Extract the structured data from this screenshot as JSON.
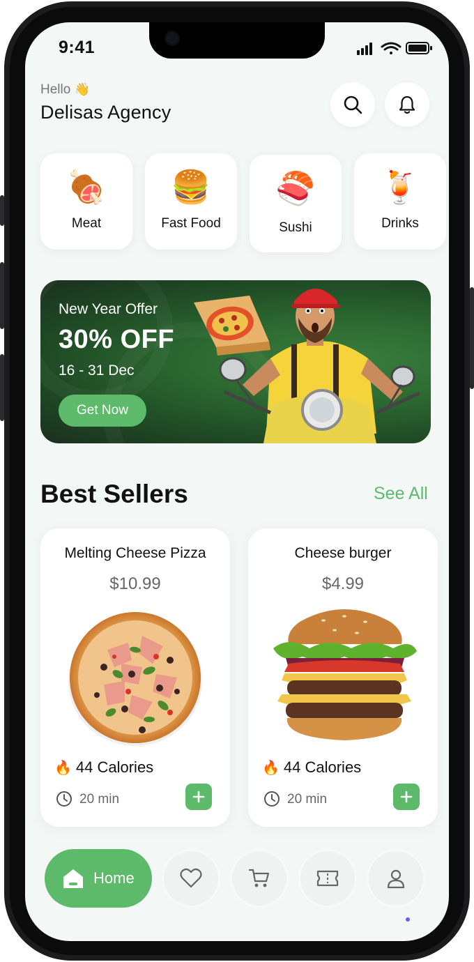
{
  "status_bar": {
    "time": "9:41"
  },
  "header": {
    "greeting": "Hello",
    "greeting_emoji": "👋",
    "username": "Delisas Agency",
    "search_icon": "search-icon",
    "bell_icon": "bell-icon"
  },
  "categories": [
    {
      "label": "Meat",
      "emoji": "🍖"
    },
    {
      "label": "Fast Food",
      "emoji": "🍔"
    },
    {
      "label": "Sushi",
      "emoji": "🍣"
    },
    {
      "label": "Drinks",
      "emoji": "🍹"
    }
  ],
  "banner": {
    "title": "New Year Offer",
    "discount": "30% OFF",
    "dates": "16 - 31 Dec",
    "button_label": "Get Now"
  },
  "best_sellers": {
    "title": "Best Sellers",
    "see_all": "See All",
    "items": [
      {
        "name": "Melting Cheese Pizza",
        "price": "$10.99",
        "calories": "44 Calories",
        "time": "20 min"
      },
      {
        "name": "Cheese burger",
        "price": "$4.99",
        "calories": "44 Calories",
        "time": "20 min"
      }
    ]
  },
  "tabbar": {
    "home_label": "Home",
    "tabs": [
      "heart-icon",
      "cart-icon",
      "ticket-icon",
      "user-icon"
    ]
  },
  "colors": {
    "accent": "#5cba6a",
    "background": "#f3f7f6",
    "banner_green": "#2c6a31"
  }
}
